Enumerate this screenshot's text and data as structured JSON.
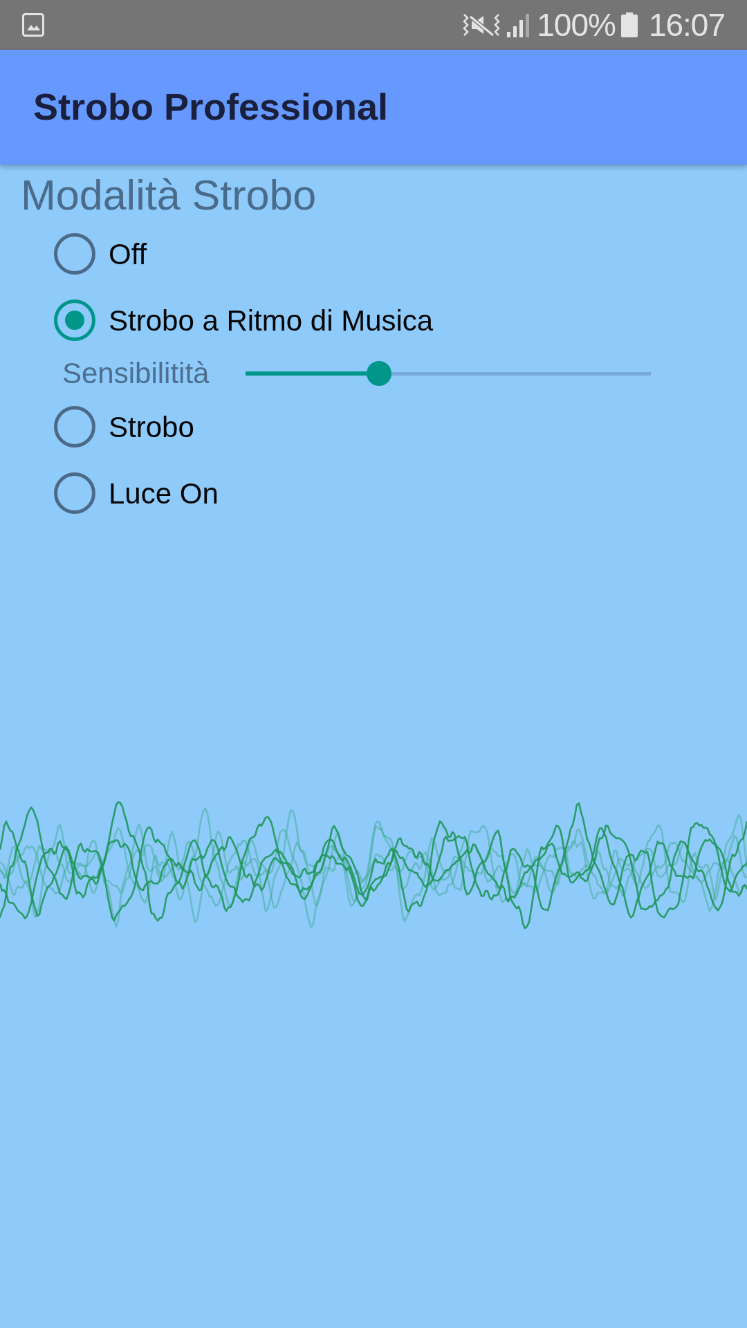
{
  "status_bar": {
    "battery": "100%",
    "time": "16:07"
  },
  "app_bar": {
    "title": "Strobo Professional"
  },
  "section": {
    "title": "Modalità Strobo"
  },
  "modes": [
    {
      "label": "Off",
      "selected": false
    },
    {
      "label": "Strobo a Ritmo di Musica",
      "selected": true,
      "slider": {
        "label": "Sensibilitità",
        "level": 0.33
      }
    },
    {
      "label": "Strobo",
      "selected": false
    },
    {
      "label": "Luce On",
      "selected": false
    }
  ]
}
